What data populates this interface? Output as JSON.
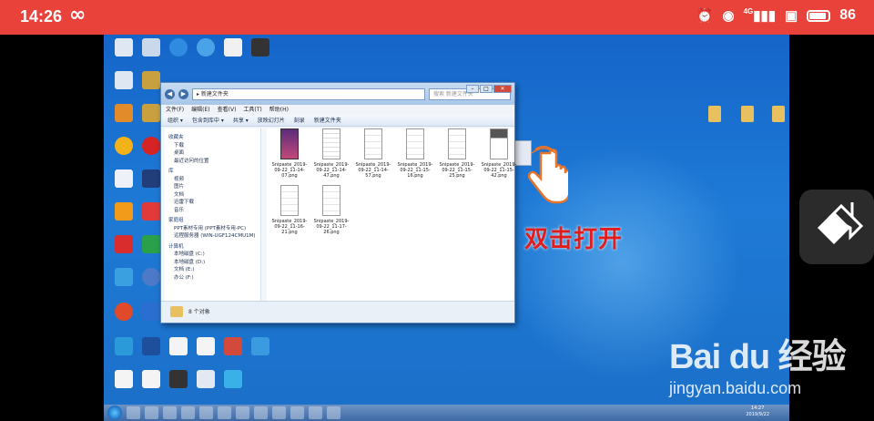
{
  "status_bar": {
    "time": "14:26",
    "left_icon": "infinity-icon",
    "right_icons": [
      "alarm-icon",
      "wifi-icon",
      "4g-signal-icon",
      "hd-icon",
      "battery-icon"
    ],
    "signal_label": "4G",
    "battery_level": "86",
    "color": "#e8423a"
  },
  "explorer": {
    "address": "▸ 新建文件夹",
    "search_placeholder": "搜索 新建文件夹",
    "menu": [
      "文件(F)",
      "编辑(E)",
      "查看(V)",
      "工具(T)",
      "帮助(H)"
    ],
    "toolbar": [
      "组织 ▾",
      "包含到库中 ▾",
      "共享 ▾",
      "放映幻灯片",
      "刻录",
      "新建文件夹"
    ],
    "nav": {
      "favorites_header": "收藏夹",
      "favorites": [
        "下载",
        "桌面",
        "最近访问的位置"
      ],
      "libraries_header": "库",
      "libraries": [
        "视频",
        "图片",
        "文档",
        "迅雷下载",
        "音乐"
      ],
      "homegroup_header": "家庭组",
      "network": [
        "PPT素材专用 (PPT素材专用-PC)",
        "远程服务器 (WIN-UGF124CMU1M)"
      ],
      "computer_header": "计算机",
      "drives": [
        "本地磁盘 (C:)",
        "本地磁盘 (D:)",
        "文档 (E:)",
        "办公 (F:)"
      ]
    },
    "files": [
      {
        "name": "Snipaste_2019-09-22_11-14-07.png",
        "thumb": "dark"
      },
      {
        "name": "Snipaste_2019-09-22_11-14-47.png",
        "thumb": "gray"
      },
      {
        "name": "Snipaste_2019-09-22_11-14-57.png",
        "thumb": "doc"
      },
      {
        "name": "Snipaste_2019-09-22_11-15-16.png",
        "thumb": "doc"
      },
      {
        "name": "Snipaste_2019-09-22_11-15-25.png",
        "thumb": "doc"
      },
      {
        "name": "Snipaste_2019-09-22_11-15-42.png",
        "thumb": "blk"
      },
      {
        "name": "Snipaste_2019-09-22_11-16-21.png",
        "thumb": "doc"
      },
      {
        "name": "Snipaste_2019-09-22_11-17-26.png",
        "thumb": "doc"
      }
    ],
    "status": "8 个对象"
  },
  "annotation": "双击打开",
  "watermark": {
    "logo": "Bai du 经验",
    "url": "jingyan.baidu.com"
  },
  "taskbar": {
    "clock_time": "14:27",
    "clock_date": "2019/9/22"
  },
  "floating_button_icon": "screen-mirror-icon"
}
